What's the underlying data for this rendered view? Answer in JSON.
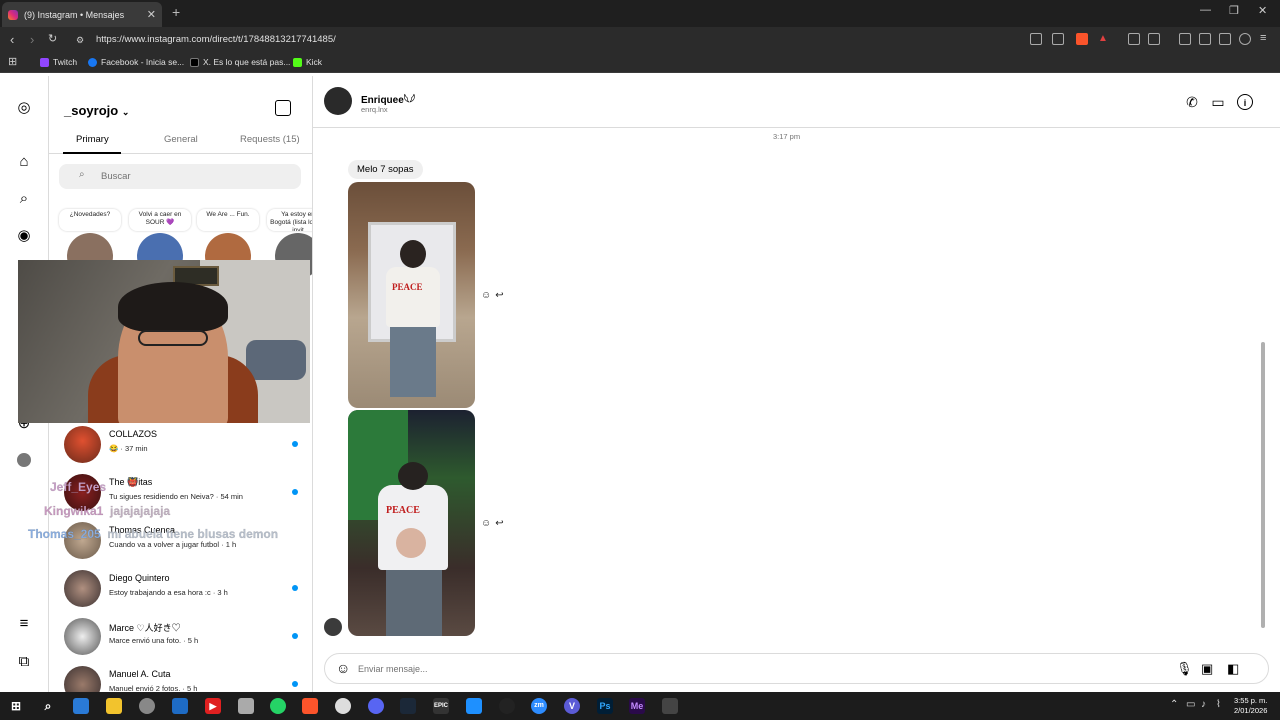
{
  "browser": {
    "tab_title": "(9) Instagram • Mensajes",
    "url": "https://www.instagram.com/direct/t/17848813217741485/",
    "bookmarks": [
      {
        "label": "Twitch",
        "color": "#9146ff"
      },
      {
        "label": "Facebook - Inicia se...",
        "color": "#1877f2"
      },
      {
        "label": "X. Es lo que está pas...",
        "color": "#000000"
      },
      {
        "label": "Kick",
        "color": "#53fc18"
      }
    ]
  },
  "sidebar": {
    "username": "_soyrojo",
    "tabs": [
      {
        "label": "Primary"
      },
      {
        "label": "General"
      },
      {
        "label": "Requests (15)"
      }
    ],
    "search_placeholder": "Buscar",
    "notes": [
      {
        "text": "¿Novedades?"
      },
      {
        "text": "Volvi a caer en SOUR 💜"
      },
      {
        "text": "We Are ... Fun."
      },
      {
        "text": "Ya estoy en Bogotá (lista lo que invit"
      }
    ],
    "conversations": [
      {
        "name": "COLLAZOS",
        "preview": "😂 · 37 min",
        "unread": true
      },
      {
        "name": "The 👹itas",
        "preview": "Tu sigues residiendo en Neiva? · 54 min",
        "unread": true
      },
      {
        "name": "Thomas Cuenca",
        "preview": "Cuando va a volver a jugar futbol · 1 h",
        "unread": false
      },
      {
        "name": "Diego Quintero",
        "preview": "Estoy trabajando a esa hora :c · 3 h",
        "unread": true
      },
      {
        "name": "Marce ♡人好き♡",
        "preview": "Marce envió una foto. · 5 h",
        "unread": true
      },
      {
        "name": "Manuel A. Cuta",
        "preview": "Manuel envió 2 fotos. · 5 h",
        "unread": true
      }
    ]
  },
  "chat_overlay": [
    {
      "user": "Jeff_Eyes",
      "text": "",
      "color": "#c8a0c8"
    },
    {
      "user": "Kingwika1",
      "text": "jajajajajaja",
      "color": "#c89ac0"
    },
    {
      "user": "Thomas_205",
      "text": "mi abuela tiene blusas demon",
      "color": "#8aaee0"
    }
  ],
  "chat": {
    "contact_name": "Enriquee𓆩𓆪",
    "contact_handle": "enrq.lnx",
    "timestamp": "3:17 pm",
    "message_text": "Melo 7 sopas",
    "photo1_print": "PEACE",
    "photo2_print": "PEACE",
    "composer_placeholder": "Enviar mensaje..."
  },
  "taskbar": {
    "time": "3:55 p. m.",
    "date": "2/01/2026"
  },
  "colors": {
    "accent_blue": "#0095f6",
    "brand": "#e1306c"
  }
}
